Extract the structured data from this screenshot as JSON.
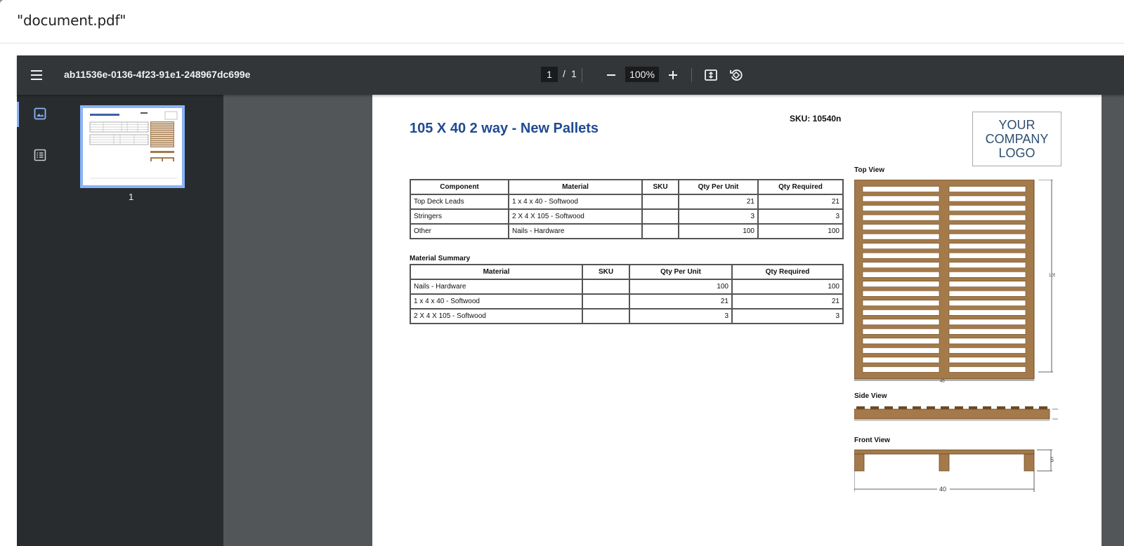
{
  "window": {
    "title": "\"document.pdf\""
  },
  "toolbar": {
    "doc_name": "ab11536e-0136-4f23-91e1-248967dc699e",
    "page_current": "1",
    "page_sep": "/",
    "page_total": "1",
    "zoom": "100%",
    "icons": [
      "menu-icon",
      "zoom-out-icon",
      "zoom-in-icon",
      "fit-page-icon",
      "rotate-icon"
    ]
  },
  "sidebar": {
    "icons": [
      "thumbnail-icon",
      "outline-icon"
    ],
    "thumbnail_label": "1"
  },
  "document": {
    "title": "105 X 40 2 way - New Pallets",
    "sku": "SKU: 10540n",
    "logo": [
      "YOUR",
      "COMPANY",
      "LOGO"
    ],
    "components_table": {
      "headers": [
        "Component",
        "Material",
        "SKU",
        "Qty Per Unit",
        "Qty Required"
      ],
      "rows": [
        [
          "Top Deck Leads",
          "1 x 4 x 40 - Softwood",
          "",
          "21",
          "21"
        ],
        [
          "Stringers",
          "2 X 4 X 105 - Softwood",
          "",
          "3",
          "3"
        ],
        [
          "Other",
          "Nails - Hardware",
          "",
          "100",
          "100"
        ]
      ]
    },
    "summary_label": "Material Summary",
    "summary_table": {
      "headers": [
        "Material",
        "SKU",
        "Qty Per Unit",
        "Qty Required"
      ],
      "rows": [
        [
          "Nails - Hardware",
          "",
          "100",
          "100"
        ],
        [
          "1 x 4 x 40 - Softwood",
          "",
          "21",
          "21"
        ],
        [
          "2 X 4 X 105 - Softwood",
          "",
          "3",
          "3"
        ]
      ]
    },
    "views": {
      "top": "Top View",
      "side": "Side View",
      "front": "Front View",
      "top_dim_width": "40",
      "top_dim_length": "105",
      "front_dim_height": "5",
      "front_dim_width": "40"
    },
    "colors": {
      "title": "#204b91",
      "wood": "#a47a4a",
      "wood_dark": "#6b4a25"
    }
  }
}
